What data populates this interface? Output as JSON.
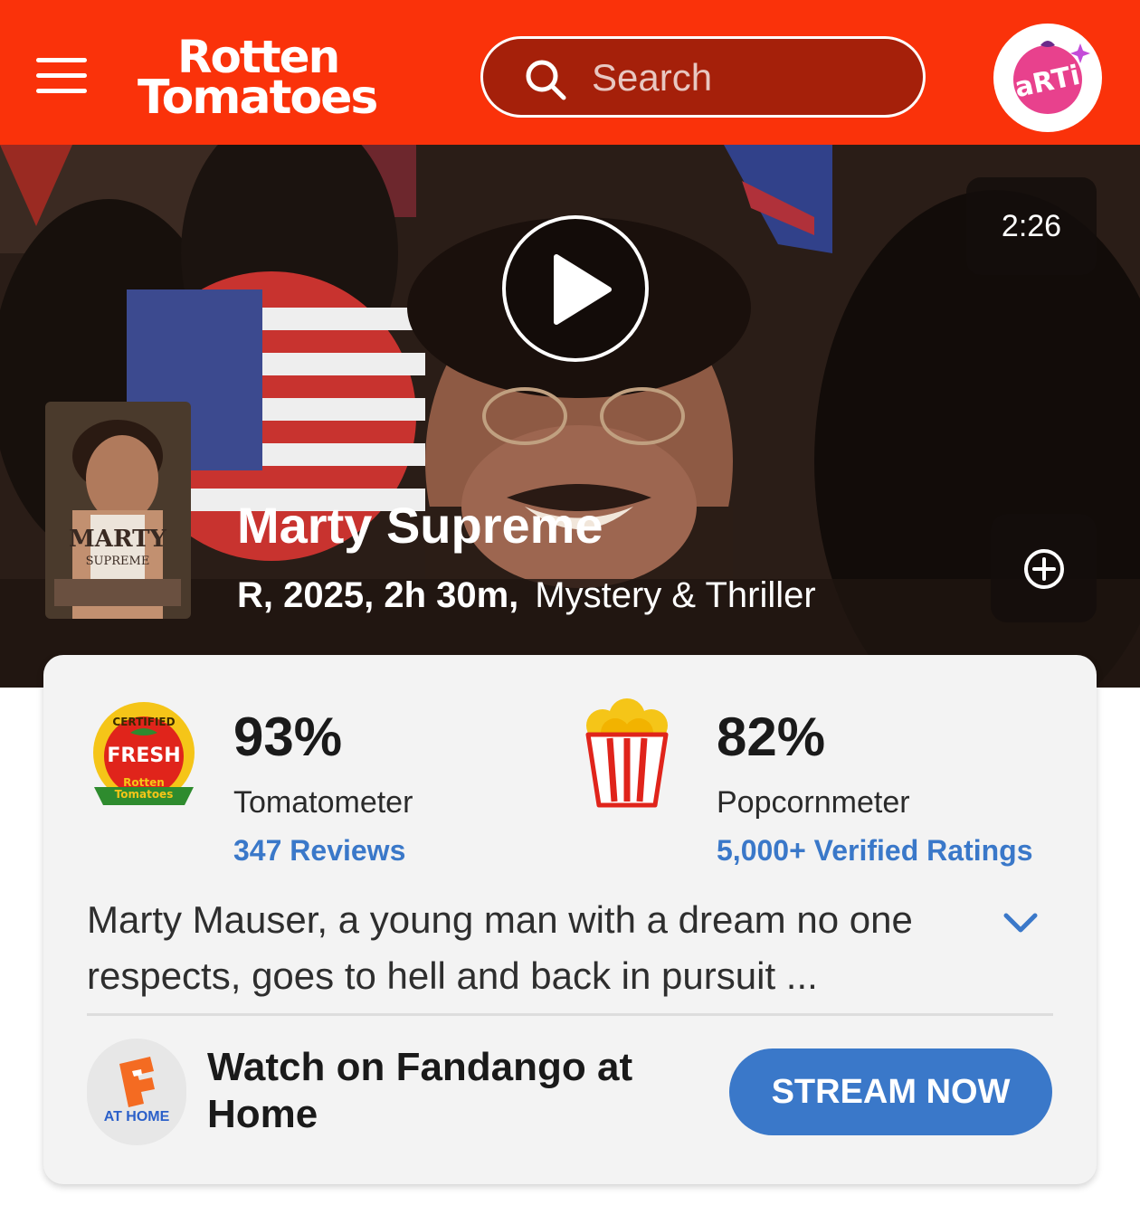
{
  "header": {
    "brand_line1": "Rotten",
    "brand_line2": "Tomatoes",
    "search_placeholder": "Search",
    "profile_badge_text": "aRTi"
  },
  "hero": {
    "video_duration": "2:26",
    "title": "Marty Supreme",
    "meta_bold": "R, 2025, 2h 30m,",
    "genre": "Mystery & Thriller",
    "poster_title": "MARTY",
    "poster_subtitle": "SUPREME"
  },
  "scores": {
    "tomatometer": {
      "value": "93%",
      "label": "Tomatometer",
      "link": "347 Reviews",
      "badge_top": "CERTIFIED",
      "badge_middle": "FRESH",
      "badge_bottom_1": "Rotten",
      "badge_bottom_2": "Tomatoes"
    },
    "popcornmeter": {
      "value": "82%",
      "label": "Popcornmeter",
      "link": "5,000+ Verified Ratings"
    }
  },
  "synopsis": "Marty Mauser, a young man with a dream no one respects, goes to hell and back in pursuit ...",
  "watch": {
    "logo_text": "AT HOME",
    "text": "Watch on Fandango at Home",
    "button_label": "STREAM NOW"
  },
  "colors": {
    "brand_red": "#fa320a",
    "link_blue": "#3a78c9"
  },
  "icons": [
    "menu-icon",
    "search-icon",
    "play-icon",
    "add-circle-icon",
    "chevron-down-icon",
    "popcorn-icon",
    "certified-fresh-icon",
    "fandango-icon"
  ]
}
